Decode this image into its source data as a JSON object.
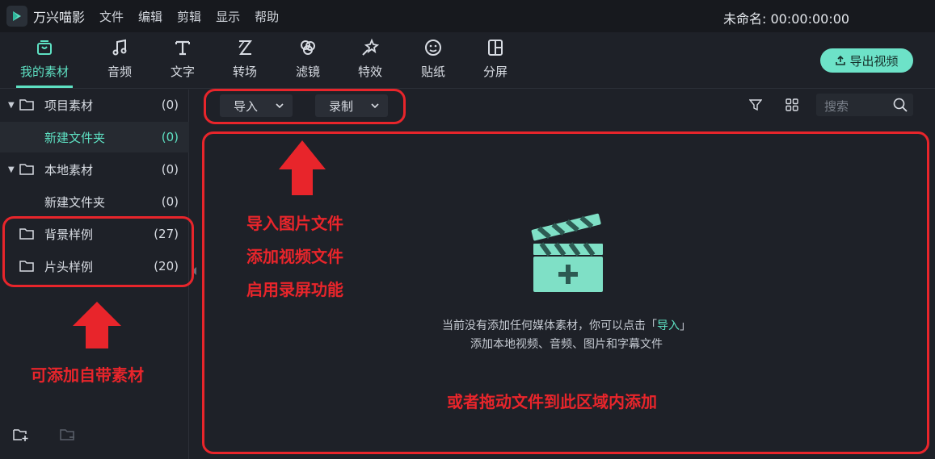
{
  "app": {
    "name": "万兴喵影",
    "project_title": "未命名: 00:00:00:00"
  },
  "menu": [
    "文件",
    "编辑",
    "剪辑",
    "显示",
    "帮助"
  ],
  "toolbar": {
    "tools": [
      {
        "label": "我的素材",
        "icon": "media-icon",
        "active": true
      },
      {
        "label": "音频",
        "icon": "music-icon"
      },
      {
        "label": "文字",
        "icon": "text-icon"
      },
      {
        "label": "转场",
        "icon": "transition-icon"
      },
      {
        "label": "滤镜",
        "icon": "filter-icon"
      },
      {
        "label": "特效",
        "icon": "effects-icon"
      },
      {
        "label": "贴纸",
        "icon": "sticker-icon"
      },
      {
        "label": "分屏",
        "icon": "split-screen-icon"
      }
    ],
    "export_label": "导出视频"
  },
  "sidebar": {
    "items": [
      {
        "label": "项目素材",
        "count": "(0)"
      },
      {
        "label": "新建文件夹",
        "count": "(0)"
      },
      {
        "label": "本地素材",
        "count": "(0)"
      },
      {
        "label": "新建文件夹",
        "count": "(0)"
      },
      {
        "label": "背景样例",
        "count": "(27)"
      },
      {
        "label": "片头样例",
        "count": "(20)"
      }
    ]
  },
  "subbar": {
    "import_label": "导入",
    "record_label": "录制",
    "search_placeholder": "搜索"
  },
  "empty": {
    "line1_prefix": "当前没有添加任何媒体素材，你可以点击「",
    "line1_link": "导入",
    "line1_suffix": "」",
    "line2": "添加本地视频、音频、图片和字幕文件"
  },
  "annotations": {
    "import_notes": [
      "导入图片文件",
      "添加视频文件",
      "启用录屏功能"
    ],
    "sidebar_note": "可添加自带素材",
    "drop_note": "或者拖动文件到此区域内添加"
  },
  "colors": {
    "accent": "#5ee1c3",
    "annotation_red": "#e8252b",
    "background": "#1e2128"
  }
}
